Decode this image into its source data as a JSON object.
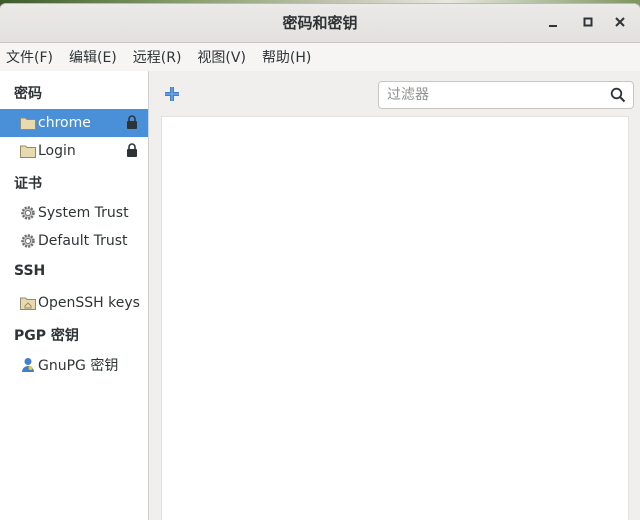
{
  "window": {
    "title": "密码和密钥"
  },
  "menu": [
    "文件(F)",
    "编辑(E)",
    "远程(R)",
    "视图(V)",
    "帮助(H)"
  ],
  "sidebar": {
    "sections": [
      {
        "header": "密码",
        "items": [
          {
            "label": "chrome",
            "icon": "folder-icon",
            "locked": true,
            "selected": true
          },
          {
            "label": "Login",
            "icon": "folder-icon",
            "locked": true,
            "selected": false
          }
        ]
      },
      {
        "header": "证书",
        "items": [
          {
            "label": "System Trust",
            "icon": "gear-icon"
          },
          {
            "label": "Default Trust",
            "icon": "gear-icon"
          }
        ]
      },
      {
        "header": "SSH",
        "items": [
          {
            "label": "OpenSSH keys",
            "icon": "folder-home-icon"
          }
        ]
      },
      {
        "header": "PGP 密钥",
        "items": [
          {
            "label": "GnuPG 密钥",
            "icon": "person-key-icon"
          }
        ]
      }
    ]
  },
  "toolbar": {
    "filter_placeholder": "过滤器",
    "filter_value": ""
  },
  "colors": {
    "selection": "#4a90d9",
    "add_icon": "#3f7fcc"
  }
}
